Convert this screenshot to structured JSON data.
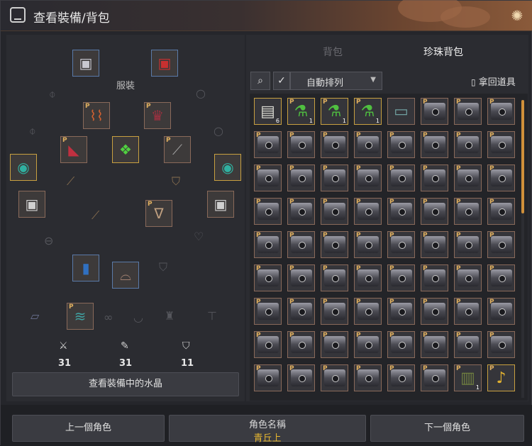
{
  "window": {
    "title": "查看裝備/背包"
  },
  "left": {
    "costume_label": "服裝",
    "stats": [
      {
        "icon": "sword-icon",
        "value": "31"
      },
      {
        "icon": "quill-icon",
        "value": "31"
      },
      {
        "icon": "shield-icon",
        "value": "11"
      }
    ],
    "view_crystals_label": "查看裝備中的水晶"
  },
  "tabs": [
    {
      "label": "背包",
      "active": false
    },
    {
      "label": "珍珠背包",
      "active": true
    }
  ],
  "toolbar": {
    "search_icon": "magnifier-icon",
    "checkbox_checked": true,
    "sort_label": "自動排列",
    "retrieve_label": "拿回道具"
  },
  "inventory": {
    "rows": 9,
    "columns": 8,
    "special_items": [
      {
        "index": 0,
        "name": "scroll",
        "count": "6"
      },
      {
        "index": 1,
        "name": "green-potion",
        "count": "1"
      },
      {
        "index": 2,
        "name": "green-potion",
        "count": "1"
      },
      {
        "index": 3,
        "name": "green-potion",
        "count": "1"
      },
      {
        "index": 4,
        "name": "map-scroll",
        "count": ""
      },
      {
        "index": 70,
        "name": "green-book",
        "count": "1"
      },
      {
        "index": 71,
        "name": "gold-horn",
        "count": ""
      }
    ],
    "default_item": "pearl-chest"
  },
  "footer": {
    "prev_label": "上一個角色",
    "char_name_label": "角色名稱",
    "char_name_value": "青丘上",
    "next_label": "下一個角色"
  }
}
